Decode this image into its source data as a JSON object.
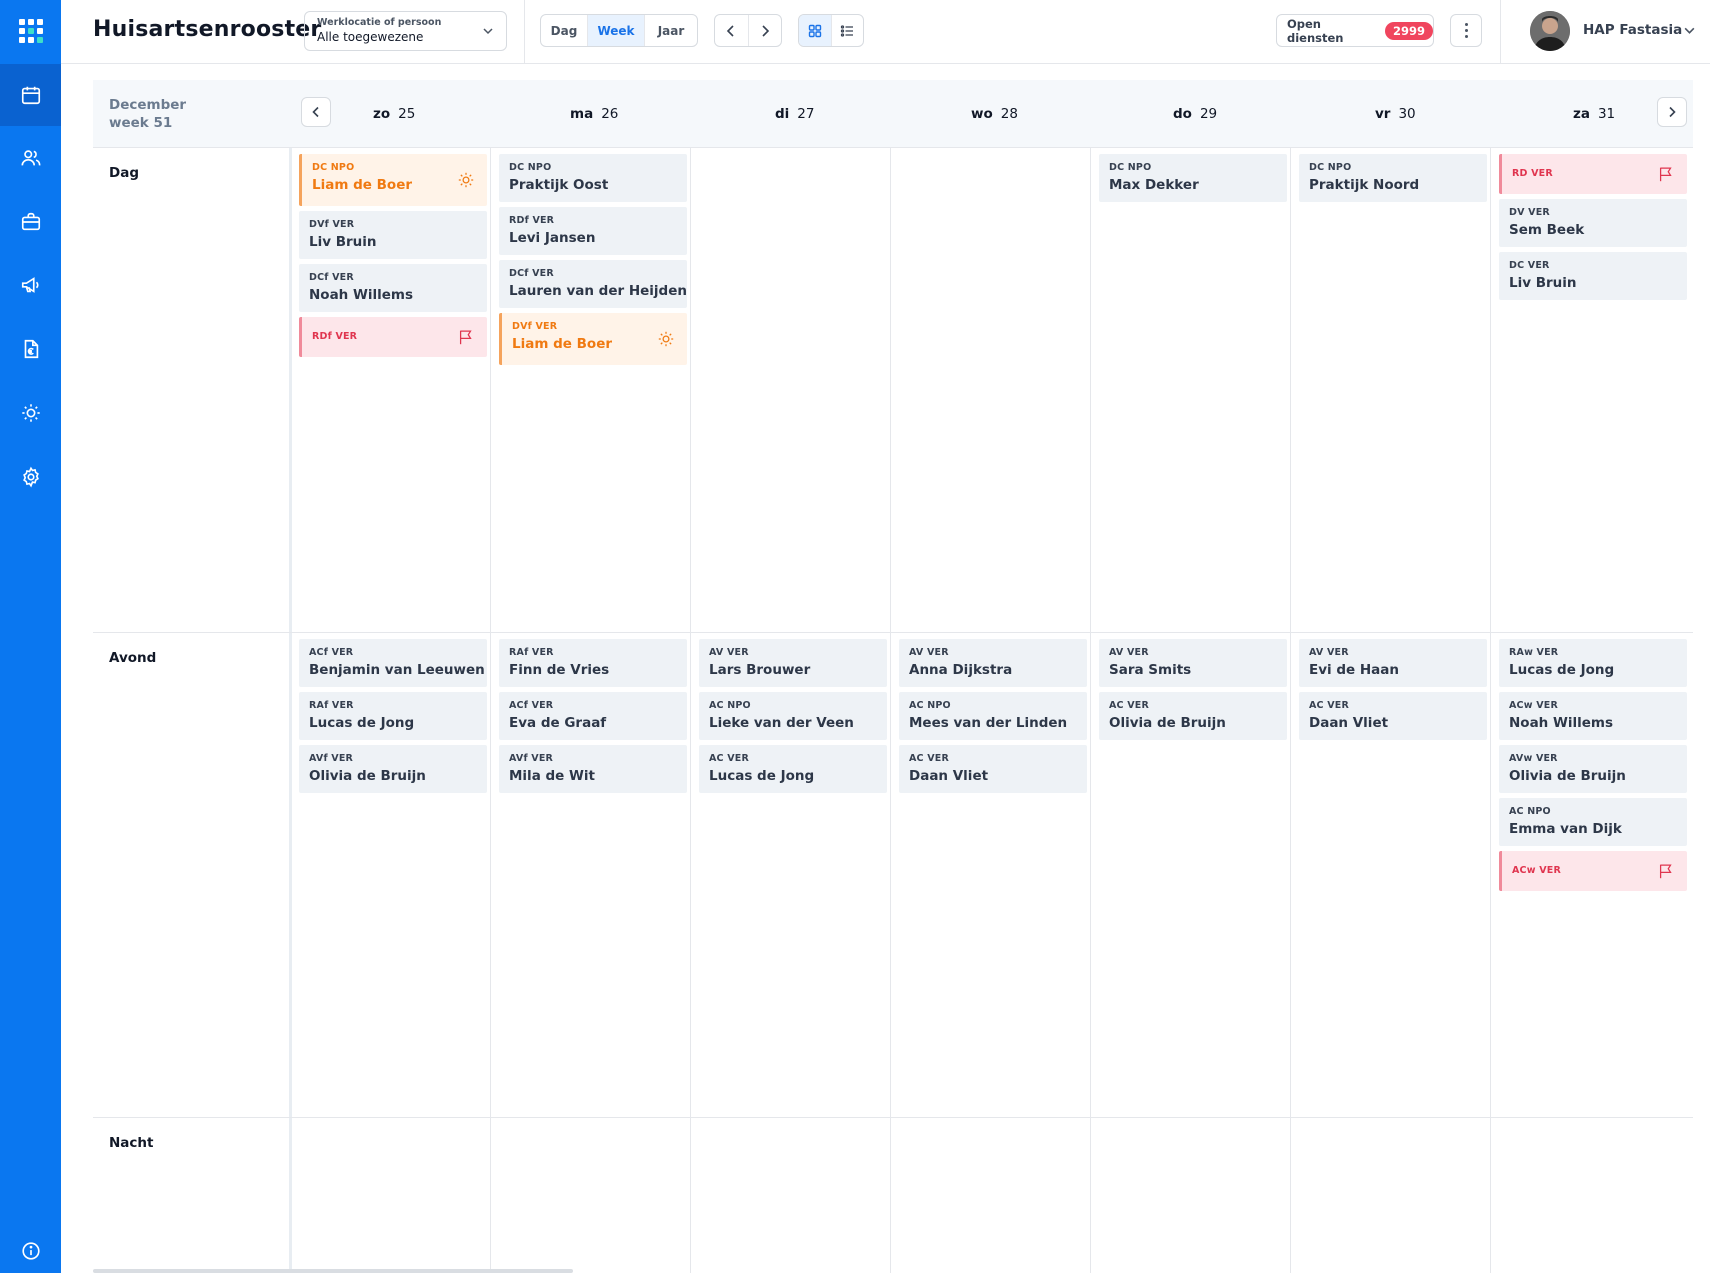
{
  "app": {
    "title": "Huisartsenrooster"
  },
  "location_select": {
    "label": "Werklocatie of persoon",
    "value": "Alle toegewezene"
  },
  "view_modes": [
    "Dag",
    "Week",
    "Jaar"
  ],
  "active_view": "Week",
  "open_shifts": {
    "label": "Open diensten",
    "count": "2999"
  },
  "user": {
    "name": "HAP Fastasia"
  },
  "sidebar": {
    "icons": [
      "calendar-icon",
      "users-icon",
      "briefcase-icon",
      "megaphone-icon",
      "invoice-icon",
      "sun-icon",
      "gear-icon"
    ],
    "bottom_icon": "info-icon"
  },
  "colors": {
    "sidebar": "#0a77f0",
    "accent": "#1a73e8",
    "badge": "#f0455e",
    "vacation": "#f07a12",
    "open": "#e0354f"
  },
  "calendar": {
    "month": "December",
    "week": "week 51",
    "days": [
      {
        "abbr": "zo",
        "num": "25"
      },
      {
        "abbr": "ma",
        "num": "26"
      },
      {
        "abbr": "di",
        "num": "27"
      },
      {
        "abbr": "wo",
        "num": "28"
      },
      {
        "abbr": "do",
        "num": "29"
      },
      {
        "abbr": "vr",
        "num": "30"
      },
      {
        "abbr": "za",
        "num": "31"
      }
    ],
    "rows": [
      {
        "label": "Dag",
        "cells": [
          [
            {
              "code": "DC NPO",
              "name": "Liam de Boer",
              "type": "vacation",
              "icon": "sun-icon"
            },
            {
              "code": "DVf VER",
              "name": "Liv Bruin"
            },
            {
              "code": "DCf VER",
              "name": "Noah Willems"
            },
            {
              "code": "RDf VER",
              "name": "",
              "type": "open",
              "icon": "flag-icon"
            }
          ],
          [
            {
              "code": "DC NPO",
              "name": "Praktijk Oost"
            },
            {
              "code": "RDf VER",
              "name": "Levi Jansen"
            },
            {
              "code": "DCf VER",
              "name": "Lauren van der Heijden"
            },
            {
              "code": "DVf VER",
              "name": "Liam de Boer",
              "type": "vacation",
              "icon": "sun-icon"
            }
          ],
          [],
          [],
          [
            {
              "code": "DC NPO",
              "name": "Max Dekker"
            }
          ],
          [
            {
              "code": "DC NPO",
              "name": "Praktijk Noord"
            }
          ],
          [
            {
              "code": "RD VER",
              "name": "",
              "type": "open",
              "icon": "flag-icon"
            },
            {
              "code": "DV VER",
              "name": "Sem Beek"
            },
            {
              "code": "DC VER",
              "name": "Liv Bruin"
            }
          ]
        ]
      },
      {
        "label": "Avond",
        "cells": [
          [
            {
              "code": "ACf VER",
              "name": "Benjamin van Leeuwen"
            },
            {
              "code": "RAf VER",
              "name": "Lucas de Jong"
            },
            {
              "code": "AVf VER",
              "name": "Olivia de Bruijn"
            }
          ],
          [
            {
              "code": "RAf VER",
              "name": "Finn de Vries"
            },
            {
              "code": "ACf VER",
              "name": "Eva de Graaf"
            },
            {
              "code": "AVf VER",
              "name": "Mila de Wit"
            }
          ],
          [
            {
              "code": "AV VER",
              "name": "Lars Brouwer"
            },
            {
              "code": "AC NPO",
              "name": "Lieke van der Veen"
            },
            {
              "code": "AC VER",
              "name": "Lucas de Jong"
            }
          ],
          [
            {
              "code": "AV VER",
              "name": "Anna Dijkstra"
            },
            {
              "code": "AC NPO",
              "name": "Mees van der Linden"
            },
            {
              "code": "AC VER",
              "name": "Daan Vliet"
            }
          ],
          [
            {
              "code": "AV VER",
              "name": "Sara Smits"
            },
            {
              "code": "AC VER",
              "name": "Olivia de Bruijn"
            }
          ],
          [
            {
              "code": "AV VER",
              "name": "Evi de Haan"
            },
            {
              "code": "AC VER",
              "name": "Daan Vliet"
            }
          ],
          [
            {
              "code": "RAw VER",
              "name": "Lucas de Jong"
            },
            {
              "code": "ACw VER",
              "name": "Noah Willems"
            },
            {
              "code": "AVw VER",
              "name": "Olivia de Bruijn"
            },
            {
              "code": "AC NPO",
              "name": "Emma van Dijk"
            },
            {
              "code": "ACw VER",
              "name": "",
              "type": "open",
              "icon": "flag-icon"
            }
          ]
        ]
      },
      {
        "label": "Nacht",
        "cells": [
          [],
          [],
          [],
          [],
          [],
          [],
          []
        ]
      }
    ]
  }
}
